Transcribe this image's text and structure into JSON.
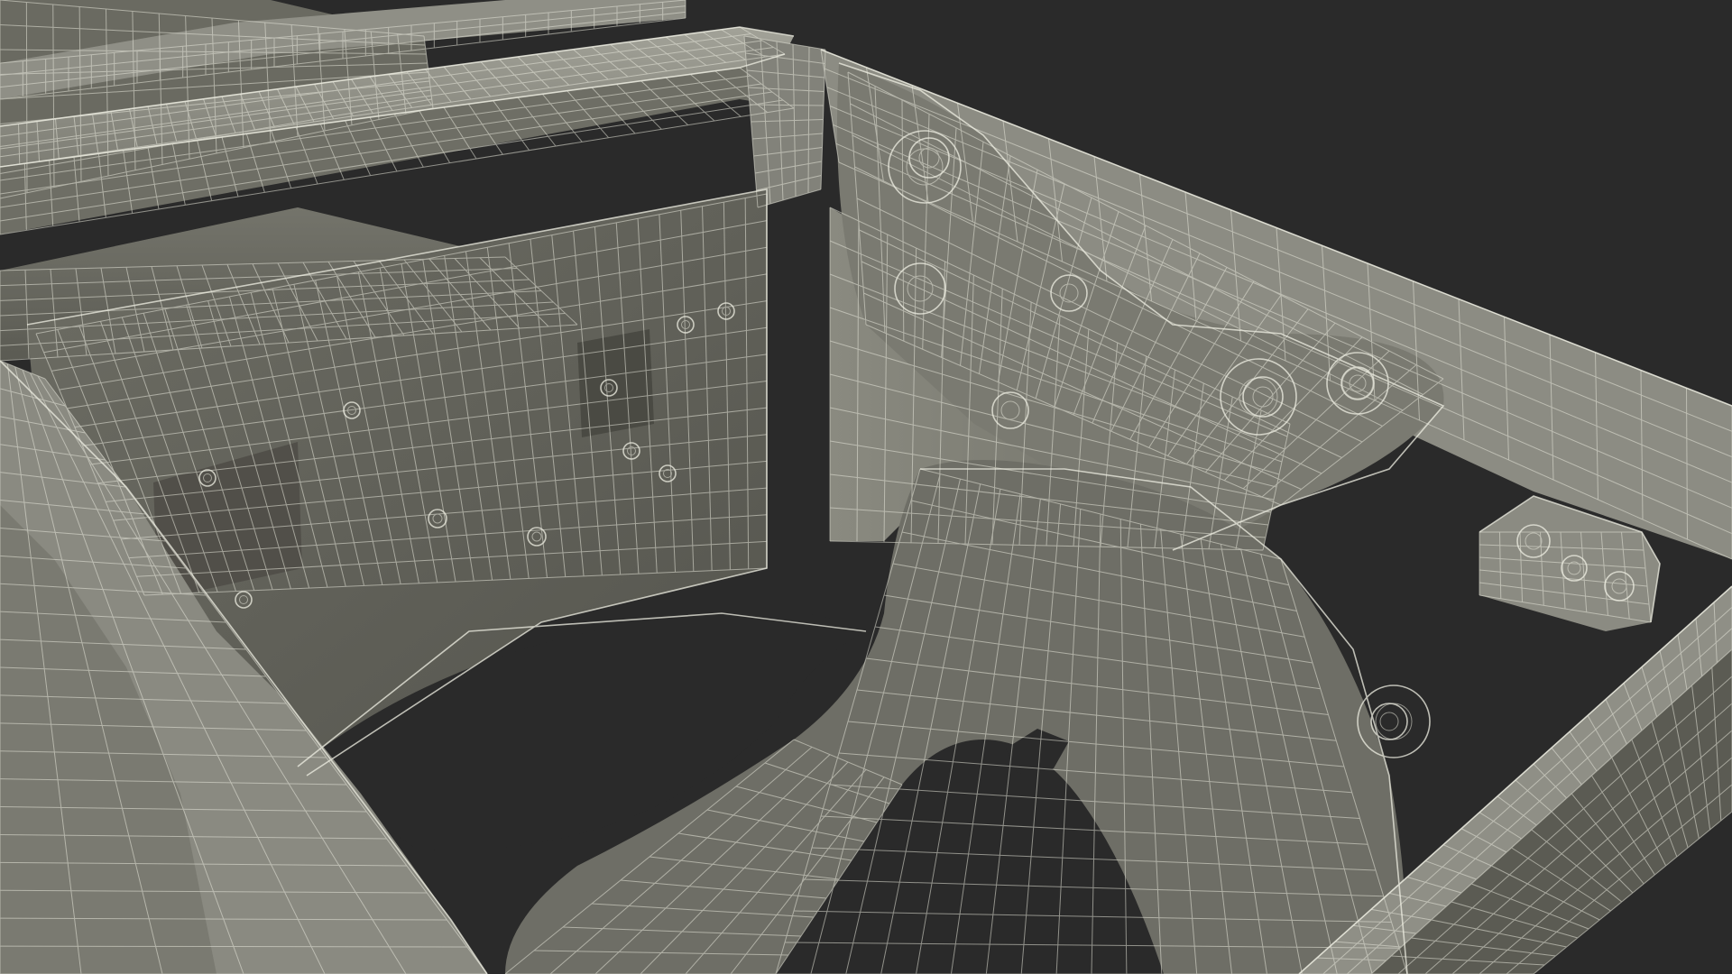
{
  "scene": {
    "subject": "vehicle-body-frame-wireframe",
    "render_mode": "shaded-with-wireframe",
    "colors": {
      "background": "#2a2a2a",
      "surface_light": "#8e8e84",
      "surface_mid": "#77776d",
      "surface_dark": "#5c5c54",
      "surface_shadow": "#46463f",
      "wire": "#e6e6da"
    }
  }
}
